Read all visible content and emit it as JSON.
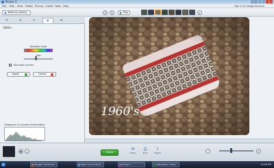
{
  "window": {
    "title": "Picasa 3",
    "controls": [
      "–",
      "□",
      "✕"
    ]
  },
  "menu": {
    "items": [
      "File",
      "Edit",
      "View",
      "Folder",
      "Picture",
      "Create",
      "Tools",
      "Help"
    ],
    "signin": "Sign in to Google Account"
  },
  "toolbar": {
    "back_label": "Back to Library",
    "play_label": "Play"
  },
  "left_panel": {
    "effect_name": "1960's",
    "border_color_label": "Rounded Color",
    "size_label": "Size",
    "checkbox_label": "Rounded Corners",
    "checkbox_checked": true,
    "apply_label": "Apply",
    "cancel_label": "Cancel",
    "histogram_title": "Histogram & Camera Information",
    "meta_lines": [
      "OLYMPUS IMAGING CORP.  1/60s",
      "FE340,X855,C560  f/3.5",
      "Focal Length: 7.7mm  ISO 100"
    ]
  },
  "photo": {
    "caption": "1960's"
  },
  "tray": {
    "share_label": "Share",
    "icons": [
      {
        "name": "email-icon",
        "label": "Email"
      },
      {
        "name": "print-icon",
        "label": "Print"
      },
      {
        "name": "export-icon",
        "label": "Export"
      }
    ]
  },
  "taskbar": {
    "items": [
      {
        "label": "Blogger: Handmade",
        "color": "#e8702a"
      },
      {
        "label": "Paper Cosmic Mana",
        "color": "#6a9bd8"
      },
      {
        "label": "Picasa 3",
        "color": "#c94ab9"
      },
      {
        "label": "Publications - Micro",
        "color": "#2a8c3c"
      }
    ],
    "clock": "10:40 PM"
  }
}
